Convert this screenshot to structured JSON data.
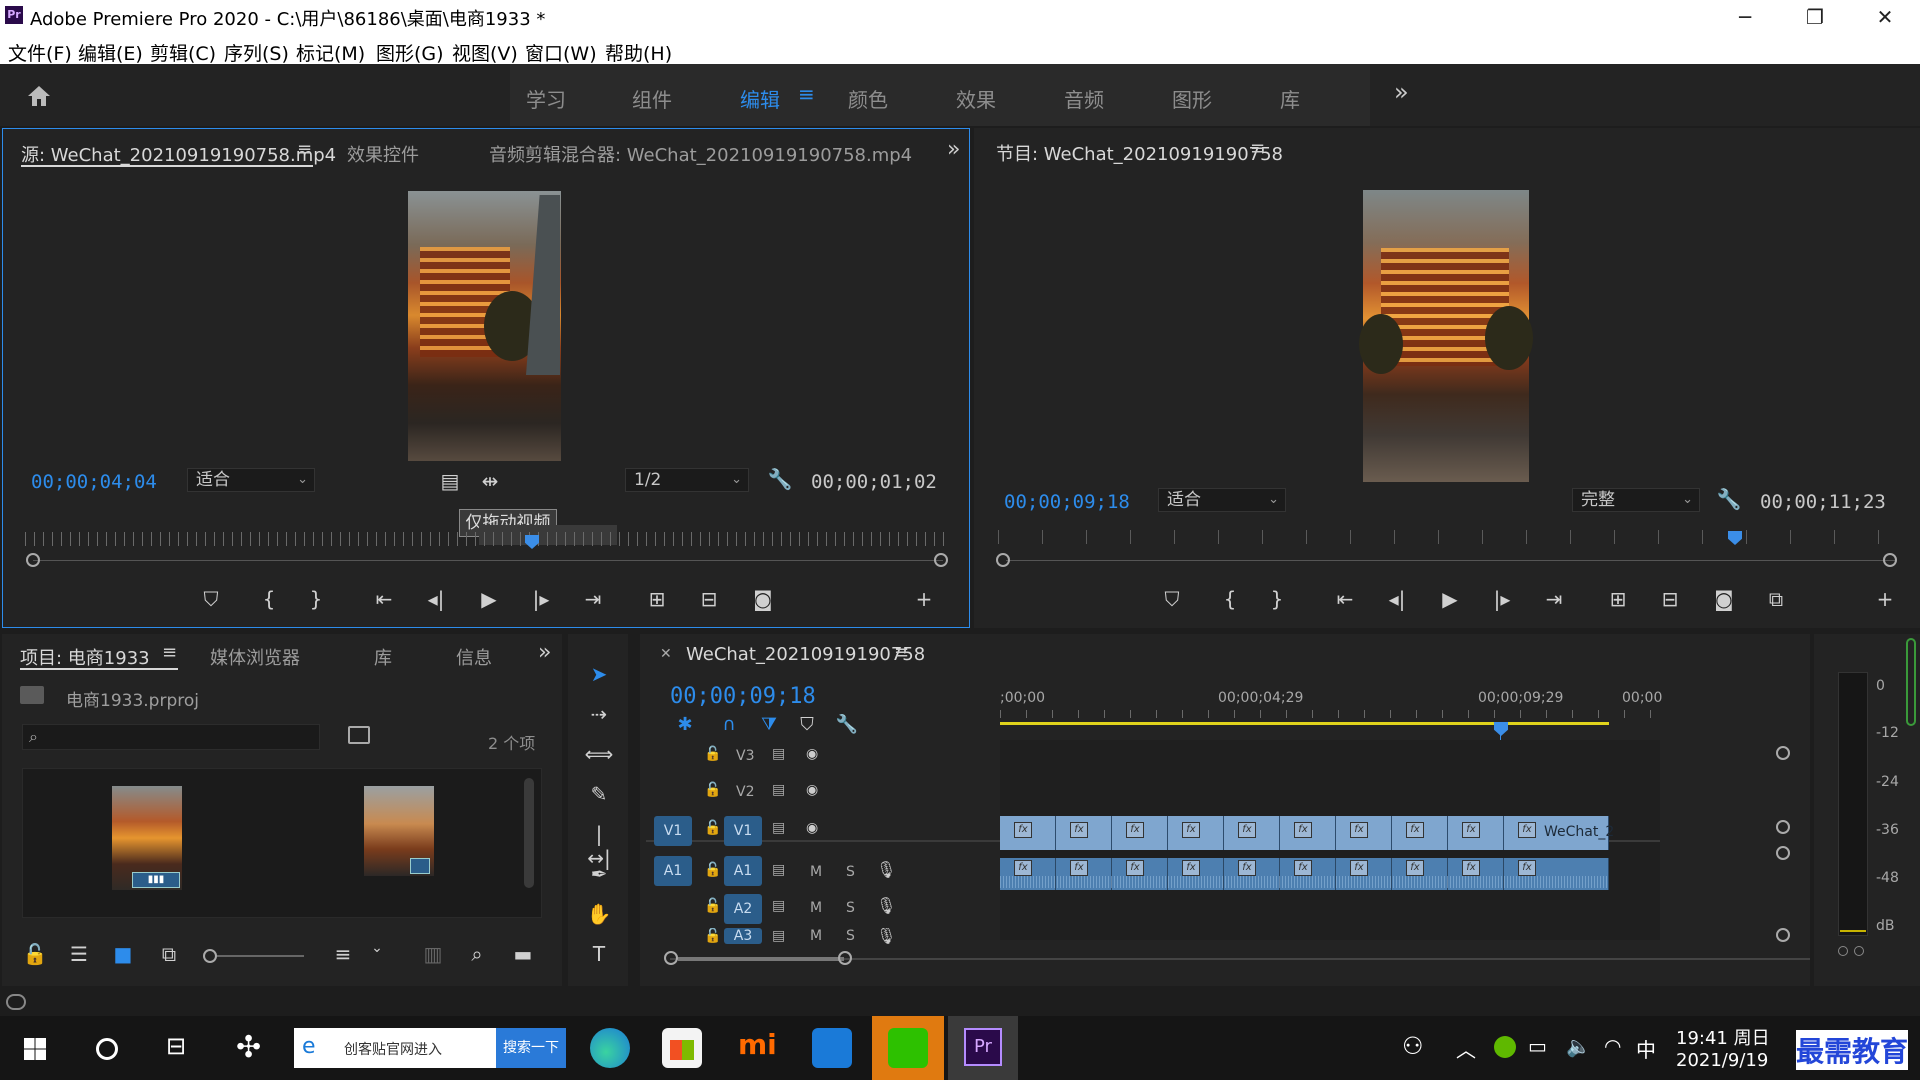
{
  "app": {
    "title": "Adobe Premiere Pro 2020 - C:\\用户\\86186\\桌面\\电商1933 *",
    "logo": "Pr",
    "window_controls": {
      "minimize": "─",
      "restore": "❐",
      "close": "✕"
    }
  },
  "menu": [
    "文件(F)",
    "编辑(E)",
    "剪辑(C)",
    "序列(S)",
    "标记(M)",
    "图形(G)",
    "视图(V)",
    "窗口(W)",
    "帮助(H)"
  ],
  "workspaces": {
    "items": [
      "学习",
      "组件",
      "编辑",
      "颜色",
      "效果",
      "音频",
      "图形",
      "库"
    ],
    "active": "编辑",
    "more": "»"
  },
  "source_panel": {
    "tabs": [
      "源: WeChat_20210919190758.mp4",
      "效果控件",
      "音频剪辑混合器: WeChat_20210919190758.mp4"
    ],
    "timecode_current": "00;00;04;04",
    "zoom": "适合",
    "resolution": "1/2",
    "timecode_duration": "00;00;01;02",
    "tooltip": "仅拖动视频",
    "playhead_fraction": 0.548
  },
  "program_panel": {
    "tab": "节目: WeChat_20210919190758",
    "timecode_current": "00;00;09;18",
    "zoom": "适合",
    "quality": "完整",
    "timecode_duration": "00;00;11;23",
    "playhead_fraction": 0.814
  },
  "project_panel": {
    "tabs": [
      "项目: 电商1933",
      "媒体浏览器",
      "库",
      "信息"
    ],
    "file": "电商1933.prproj",
    "search_placeholder": "",
    "item_count": "2 个项"
  },
  "timeline": {
    "sequence": "WeChat_20210919190758",
    "timecode": "00;00;09;18",
    "ruler_labels": [
      ";00;00",
      "00;00;04;29",
      "00;00;09;29",
      "00;00"
    ],
    "clip_label": "WeChat_2",
    "video_tracks": [
      {
        "patch": "",
        "name": "V3"
      },
      {
        "patch": "",
        "name": "V2"
      },
      {
        "patch": "V1",
        "name": "V1"
      }
    ],
    "audio_tracks": [
      {
        "patch": "A1",
        "name": "A1",
        "m": "M",
        "s": "S"
      },
      {
        "patch": "",
        "name": "A2",
        "m": "M",
        "s": "S"
      },
      {
        "patch": "",
        "name": "A3",
        "m": "M",
        "s": "S"
      }
    ]
  },
  "audio_meter": {
    "labels": [
      "0",
      "-12",
      "-24",
      "-36",
      "-48",
      "dB"
    ]
  },
  "taskbar": {
    "search_text": "创客贴官网进入",
    "search_button": "搜索一下",
    "tray_ime": "中",
    "time": "19:41 周日",
    "date": "2021/9/19",
    "watermark": "最需教育"
  },
  "colors": {
    "accent_blue": "#2d8ceb",
    "playhead": "#3b8ee8",
    "clip_video": "#7fa6cf",
    "clip_audio": "#4d7fb0",
    "work_area": "#e0d31c"
  }
}
